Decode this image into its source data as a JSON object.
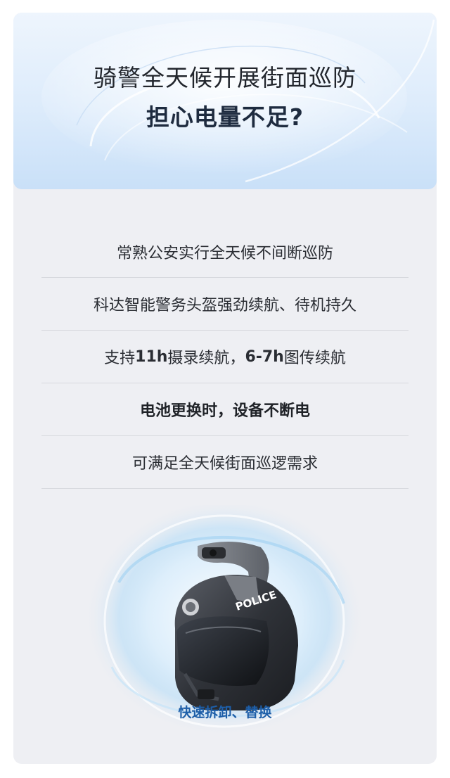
{
  "header": {
    "line1": "骑警全天候开展街面巡防",
    "line2": "担心电量不足?"
  },
  "features": [
    {
      "text": "常熟公安实行全天候不间断巡防"
    },
    {
      "text": "科达智能警务头盔强劲续航、待机持久"
    },
    {
      "pre": "支持",
      "b1": "11h",
      "mid": "摄录续航，",
      "b2": "6-7h",
      "post": "图传续航"
    },
    {
      "text": "电池更换时，设备不断电"
    },
    {
      "text": "可满足全天候街面巡逻需求"
    }
  ],
  "helmet": {
    "police_text": "POLICE",
    "caption": "快速拆卸、替换"
  },
  "colors": {
    "accent": "#1d5ea8",
    "card_bg": "#eeeff3",
    "header_top": "#eef5fd",
    "header_bottom": "#c9e0f8"
  }
}
